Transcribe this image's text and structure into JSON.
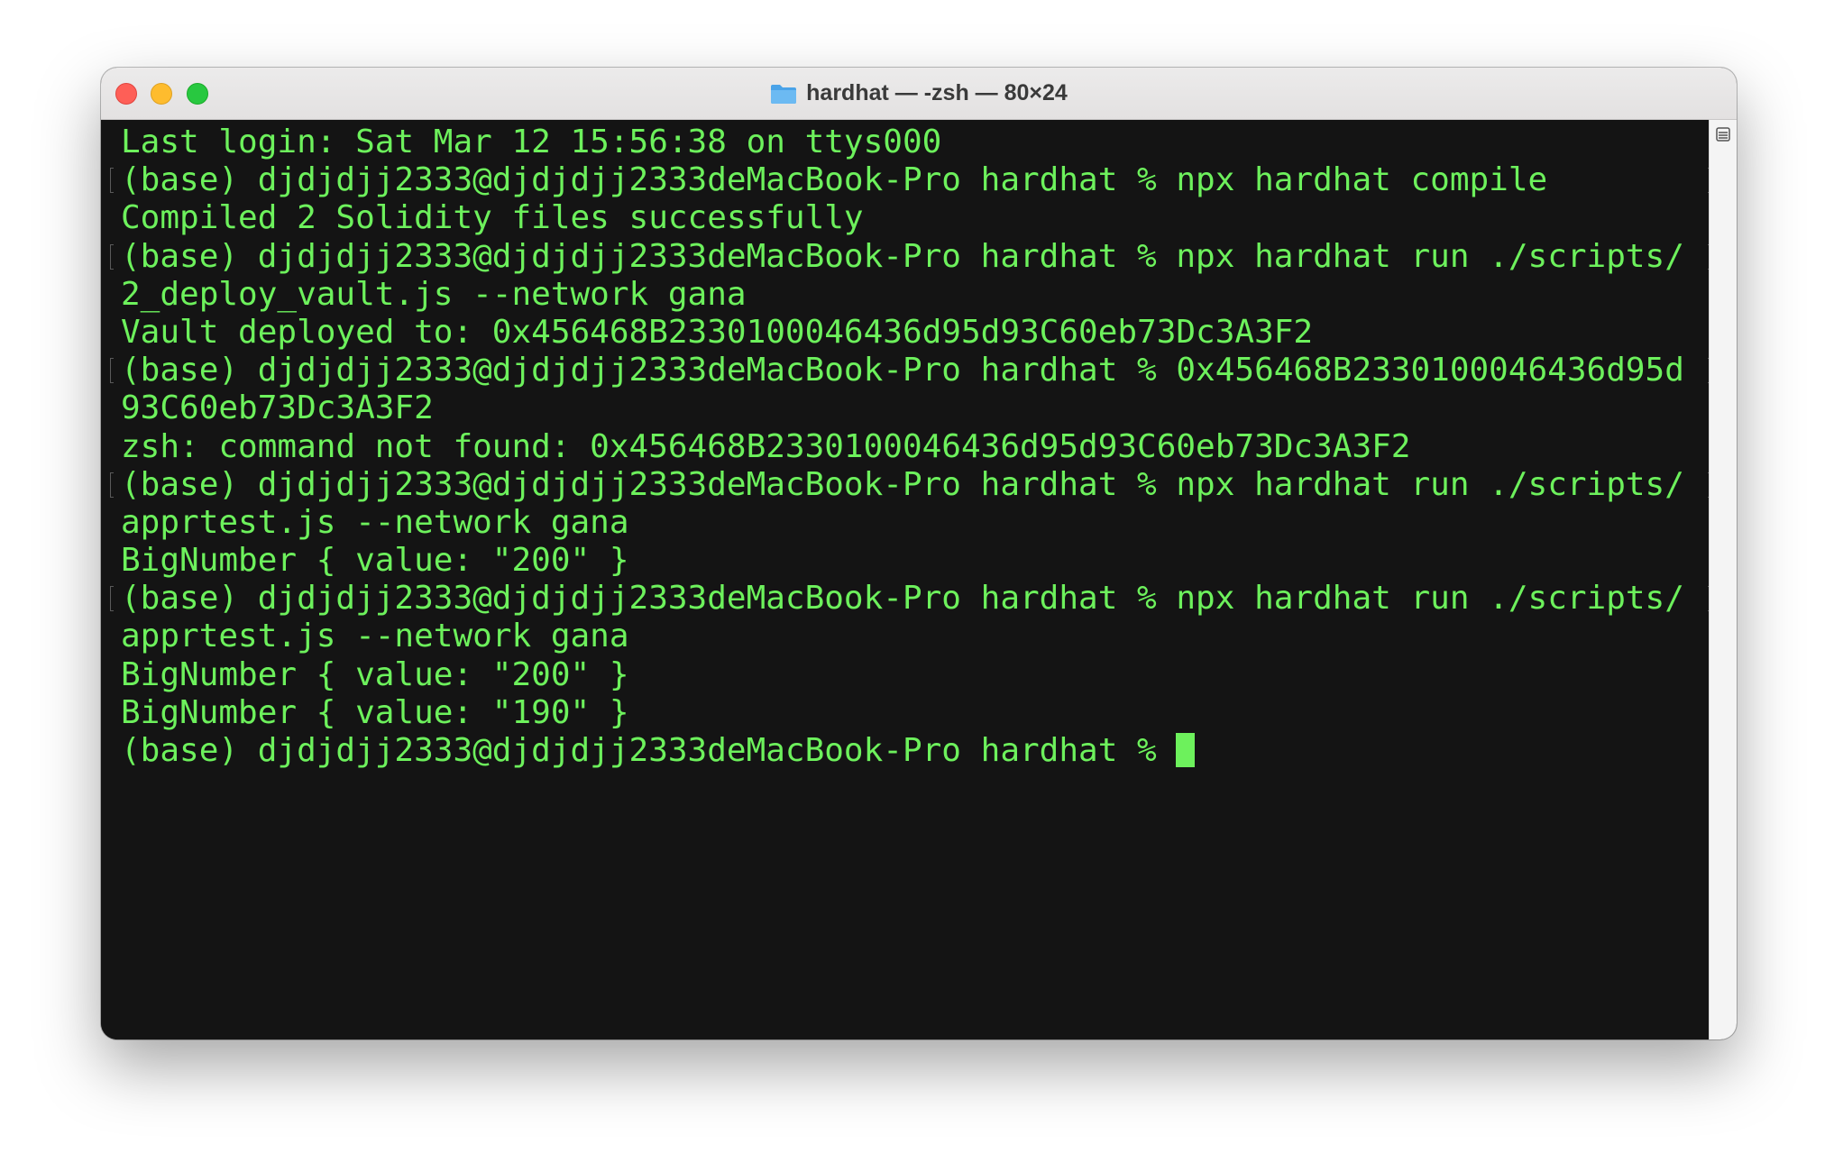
{
  "window": {
    "title": "hardhat — -zsh — 80×24",
    "folder_icon": "folder-icon"
  },
  "colors": {
    "terminal_bg": "#141414",
    "terminal_text": "#6df15c",
    "titlebar_bg": "#e8e6e6"
  },
  "terminal": {
    "lines": [
      "Last login: Sat Mar 12 15:56:38 on ttys000",
      "(base) djdjdjj2333@djdjdjj2333deMacBook-Pro hardhat % npx hardhat compile",
      "Compiled 2 Solidity files successfully",
      "(base) djdjdjj2333@djdjdjj2333deMacBook-Pro hardhat % npx hardhat run ./scripts/",
      "2_deploy_vault.js --network gana",
      "Vault deployed to: 0x456468B2330100046436d95d93C60eb73Dc3A3F2",
      "(base) djdjdjj2333@djdjdjj2333deMacBook-Pro hardhat % 0x456468B2330100046436d95d",
      "93C60eb73Dc3A3F2",
      "zsh: command not found: 0x456468B2330100046436d95d93C60eb73Dc3A3F2",
      "(base) djdjdjj2333@djdjdjj2333deMacBook-Pro hardhat % npx hardhat run ./scripts/",
      "apprtest.js --network gana",
      "BigNumber { value: \"200\" }",
      "(base) djdjdjj2333@djdjdjj2333deMacBook-Pro hardhat % npx hardhat run ./scripts/",
      "apprtest.js --network gana",
      "BigNumber { value: \"200\" }",
      "BigNumber { value: \"190\" }",
      "(base) djdjdjj2333@djdjdjj2333deMacBook-Pro hardhat % "
    ]
  }
}
